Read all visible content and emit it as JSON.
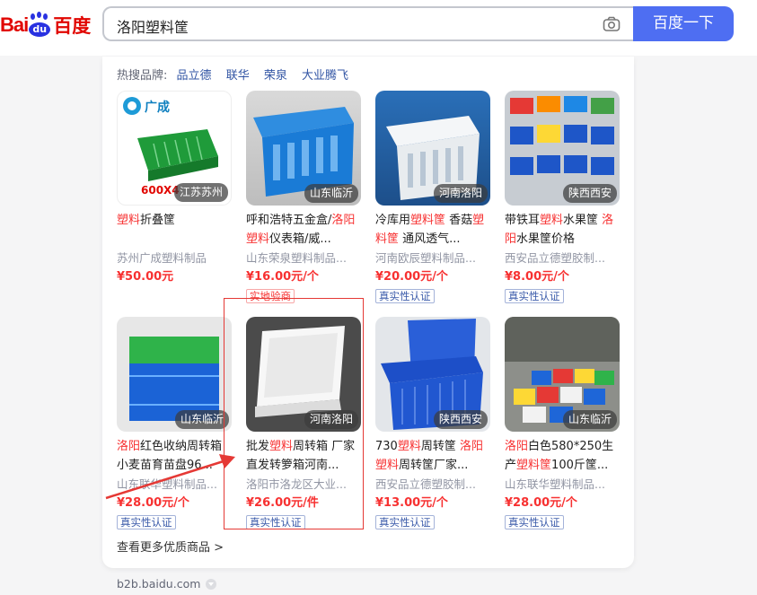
{
  "header": {
    "logo_bai": "Bai",
    "logo_du": "du",
    "logo_cn": "百度",
    "query": "洛阳塑料筐",
    "search_button": "百度一下"
  },
  "hot_brands": {
    "label": "热搜品牌:",
    "items": [
      "品立德",
      "联华",
      "荣泉",
      "大业腾飞"
    ]
  },
  "products": [
    {
      "location": "江苏苏州",
      "title_parts": [
        [
          "塑料",
          "hl"
        ],
        [
          "折叠筐",
          ""
        ]
      ],
      "shop": "苏州广成塑料制品",
      "price": "¥50.00元",
      "tag": "",
      "tag_red": "",
      "overlay": "600X4",
      "overlay2": "广成"
    },
    {
      "location": "山东临沂",
      "title_parts": [
        [
          "呼和浩特五金盒/",
          ""
        ],
        [
          "洛阳",
          "hl"
        ],
        [
          "塑料",
          "hl"
        ],
        [
          "仪表箱/威...",
          ""
        ]
      ],
      "shop": "山东荣泉塑料制品...",
      "price": "¥16.00元/个",
      "tag": "",
      "tag_red": "实地验商"
    },
    {
      "location": "河南洛阳",
      "title_parts": [
        [
          "冷库用",
          ""
        ],
        [
          "塑料筐",
          "hl"
        ],
        [
          " 香菇",
          ""
        ],
        [
          "塑料筐",
          "hl"
        ],
        [
          " 通风透气...",
          ""
        ]
      ],
      "shop": "河南欧辰塑料制品...",
      "price": "¥20.00元/个",
      "tag": "真实性认证",
      "tag_red": ""
    },
    {
      "location": "陕西西安",
      "title_parts": [
        [
          "带铁耳",
          ""
        ],
        [
          "塑料",
          "hl"
        ],
        [
          "水果筐 ",
          ""
        ],
        [
          "洛阳",
          "hl"
        ],
        [
          "水果筐价格",
          ""
        ]
      ],
      "shop": "西安品立德塑胶制...",
      "price": "¥8.00元/个",
      "tag": "真实性认证",
      "tag_red": ""
    },
    {
      "location": "山东临沂",
      "title_parts": [
        [
          "洛阳",
          "hl"
        ],
        [
          "红色收纳周转箱 小麦苗育苗盘96...",
          ""
        ]
      ],
      "shop": "山东联华塑料制品...",
      "price": "¥28.00元/个",
      "tag": "真实性认证",
      "tag_red": ""
    },
    {
      "location": "河南洛阳",
      "title_parts": [
        [
          "批发",
          ""
        ],
        [
          "塑料",
          "hl"
        ],
        [
          "周转箱 厂家直发转箩箱河南...",
          ""
        ]
      ],
      "shop": "洛阳市洛龙区大业...",
      "price": "¥26.00元/件",
      "tag": "真实性认证",
      "tag_red": ""
    },
    {
      "location": "陕西西安",
      "title_parts": [
        [
          "730",
          ""
        ],
        [
          "塑料",
          "hl"
        ],
        [
          "周转筐 ",
          ""
        ],
        [
          "洛阳",
          "hl"
        ],
        [
          "塑料",
          "hl"
        ],
        [
          "周转筐厂家...",
          ""
        ]
      ],
      "shop": "西安品立德塑胶制...",
      "price": "¥13.00元/个",
      "tag": "真实性认证",
      "tag_red": ""
    },
    {
      "location": "山东临沂",
      "title_parts": [
        [
          "洛阳",
          "hl"
        ],
        [
          "白色580*250生产",
          ""
        ],
        [
          "塑料",
          "hl"
        ],
        [
          "筐",
          "hl"
        ],
        [
          "100斤筐...",
          ""
        ]
      ],
      "shop": "山东联华塑料制品...",
      "price": "¥28.00元/个",
      "tag": "真实性认证",
      "tag_red": ""
    }
  ],
  "more_link": "查看更多优质商品 >",
  "source_domain": "b2b.baidu.com"
}
